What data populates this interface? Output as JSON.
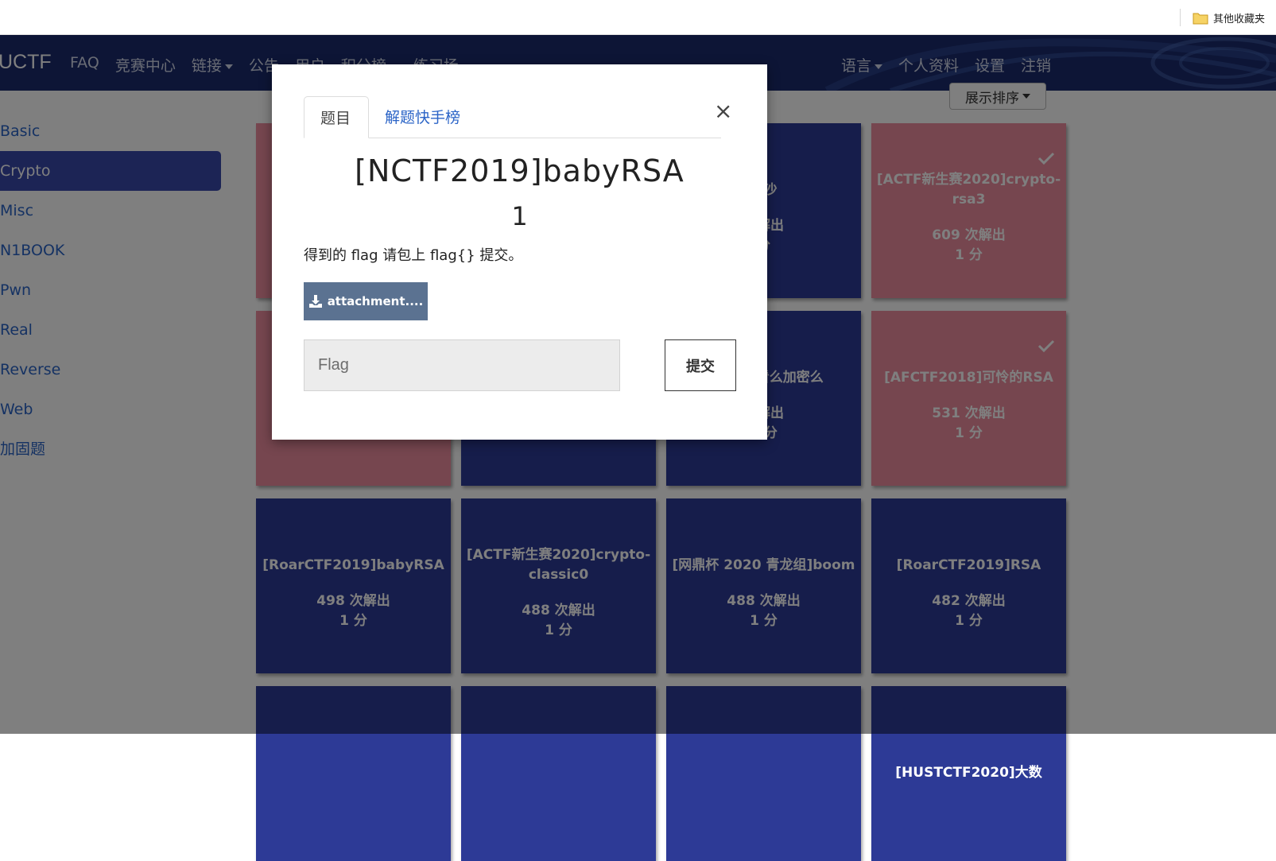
{
  "bookmarks": {
    "folder_label": "其他收藏夹"
  },
  "navbar": {
    "brand": "UCTF",
    "left_links": [
      {
        "label": "FAQ",
        "dropdown": false
      },
      {
        "label": "竞赛中心",
        "dropdown": false
      },
      {
        "label": "链接",
        "dropdown": true
      },
      {
        "label": "公告",
        "dropdown": false
      },
      {
        "label": "用户",
        "dropdown": false
      },
      {
        "label": "积分榜",
        "dropdown": true
      },
      {
        "label": "练习场",
        "dropdown": true
      }
    ],
    "right_links": [
      {
        "label": "语言",
        "dropdown": true
      },
      {
        "label": "个人资料",
        "dropdown": false
      },
      {
        "label": "设置",
        "dropdown": false
      },
      {
        "label": "注销",
        "dropdown": false
      }
    ]
  },
  "sort_button": {
    "label": "展示排序"
  },
  "sidebar": {
    "items": [
      {
        "label": "Basic",
        "active": false
      },
      {
        "label": "Crypto",
        "active": true
      },
      {
        "label": "Misc",
        "active": false
      },
      {
        "label": "N1BOOK",
        "active": false
      },
      {
        "label": "Pwn",
        "active": false
      },
      {
        "label": "Real",
        "active": false
      },
      {
        "label": "Reverse",
        "active": false
      },
      {
        "label": "Web",
        "active": false
      },
      {
        "label": "加固题",
        "active": false
      }
    ]
  },
  "challenges": [
    {
      "title": "",
      "solves": "",
      "points": "",
      "color": "pink",
      "solved": false
    },
    {
      "title": "",
      "solves": "",
      "points": "",
      "color": "blue",
      "solved": false
    },
    {
      "title": "淘沙",
      "solves": "次解出",
      "points": "分",
      "color": "blue",
      "solved": false
    },
    {
      "title": "[ACTF新生赛2020]crypto-rsa3",
      "solves": "609 次解出",
      "points": "1 分",
      "color": "pink",
      "solved": true
    },
    {
      "title": "",
      "solves": "",
      "points": "",
      "color": "pink",
      "solved": false
    },
    {
      "title": "",
      "solves": "",
      "points": "",
      "color": "blue",
      "solved": false
    },
    {
      "title": "18]你能看么加密么",
      "solves": "次解出",
      "points": "1 分",
      "color": "blue",
      "solved": false
    },
    {
      "title": "[AFCTF2018]可怜的RSA",
      "solves": "531 次解出",
      "points": "1 分",
      "color": "pink",
      "solved": true
    },
    {
      "title": "[RoarCTF2019]babyRSA",
      "solves": "498 次解出",
      "points": "1 分",
      "color": "blue",
      "solved": false
    },
    {
      "title": "[ACTF新生赛2020]crypto-classic0",
      "solves": "488 次解出",
      "points": "1 分",
      "color": "blue",
      "solved": false
    },
    {
      "title": "[网鼎杯 2020 青龙组]boom",
      "solves": "488 次解出",
      "points": "1 分",
      "color": "blue",
      "solved": false
    },
    {
      "title": "[RoarCTF2019]RSA",
      "solves": "482 次解出",
      "points": "1 分",
      "color": "blue",
      "solved": false
    },
    {
      "title": "",
      "solves": "",
      "points": "",
      "color": "blue",
      "solved": false
    },
    {
      "title": "",
      "solves": "",
      "points": "",
      "color": "blue",
      "solved": false
    },
    {
      "title": "",
      "solves": "",
      "points": "",
      "color": "blue",
      "solved": false
    },
    {
      "title": "[HUSTCTF2020]大数",
      "solves": "",
      "points": "",
      "color": "blue",
      "solved": false
    }
  ],
  "modal": {
    "tabs": [
      {
        "label": "题目",
        "active": true
      },
      {
        "label": "解题快手榜",
        "active": false
      }
    ],
    "close_label": "×",
    "title": "[NCTF2019]babyRSA",
    "points": "1",
    "description": "得到的 flag 请包上 flag{} 提交。",
    "attachment_label": "attachment....",
    "flag_placeholder": "Flag",
    "flag_value": "",
    "submit_label": "提交"
  },
  "colors": {
    "navbar": "#1a2a6c",
    "card_blue": "#2d3a96",
    "card_pink": "#ec8d9f",
    "link": "#2b64c7",
    "attachment_button": "#5b7291"
  },
  "icons": {
    "bookmark_folder": "folder-icon",
    "attachment": "download-icon",
    "solved": "check-icon",
    "close": "close-icon",
    "dropdown": "caret-down-icon"
  }
}
